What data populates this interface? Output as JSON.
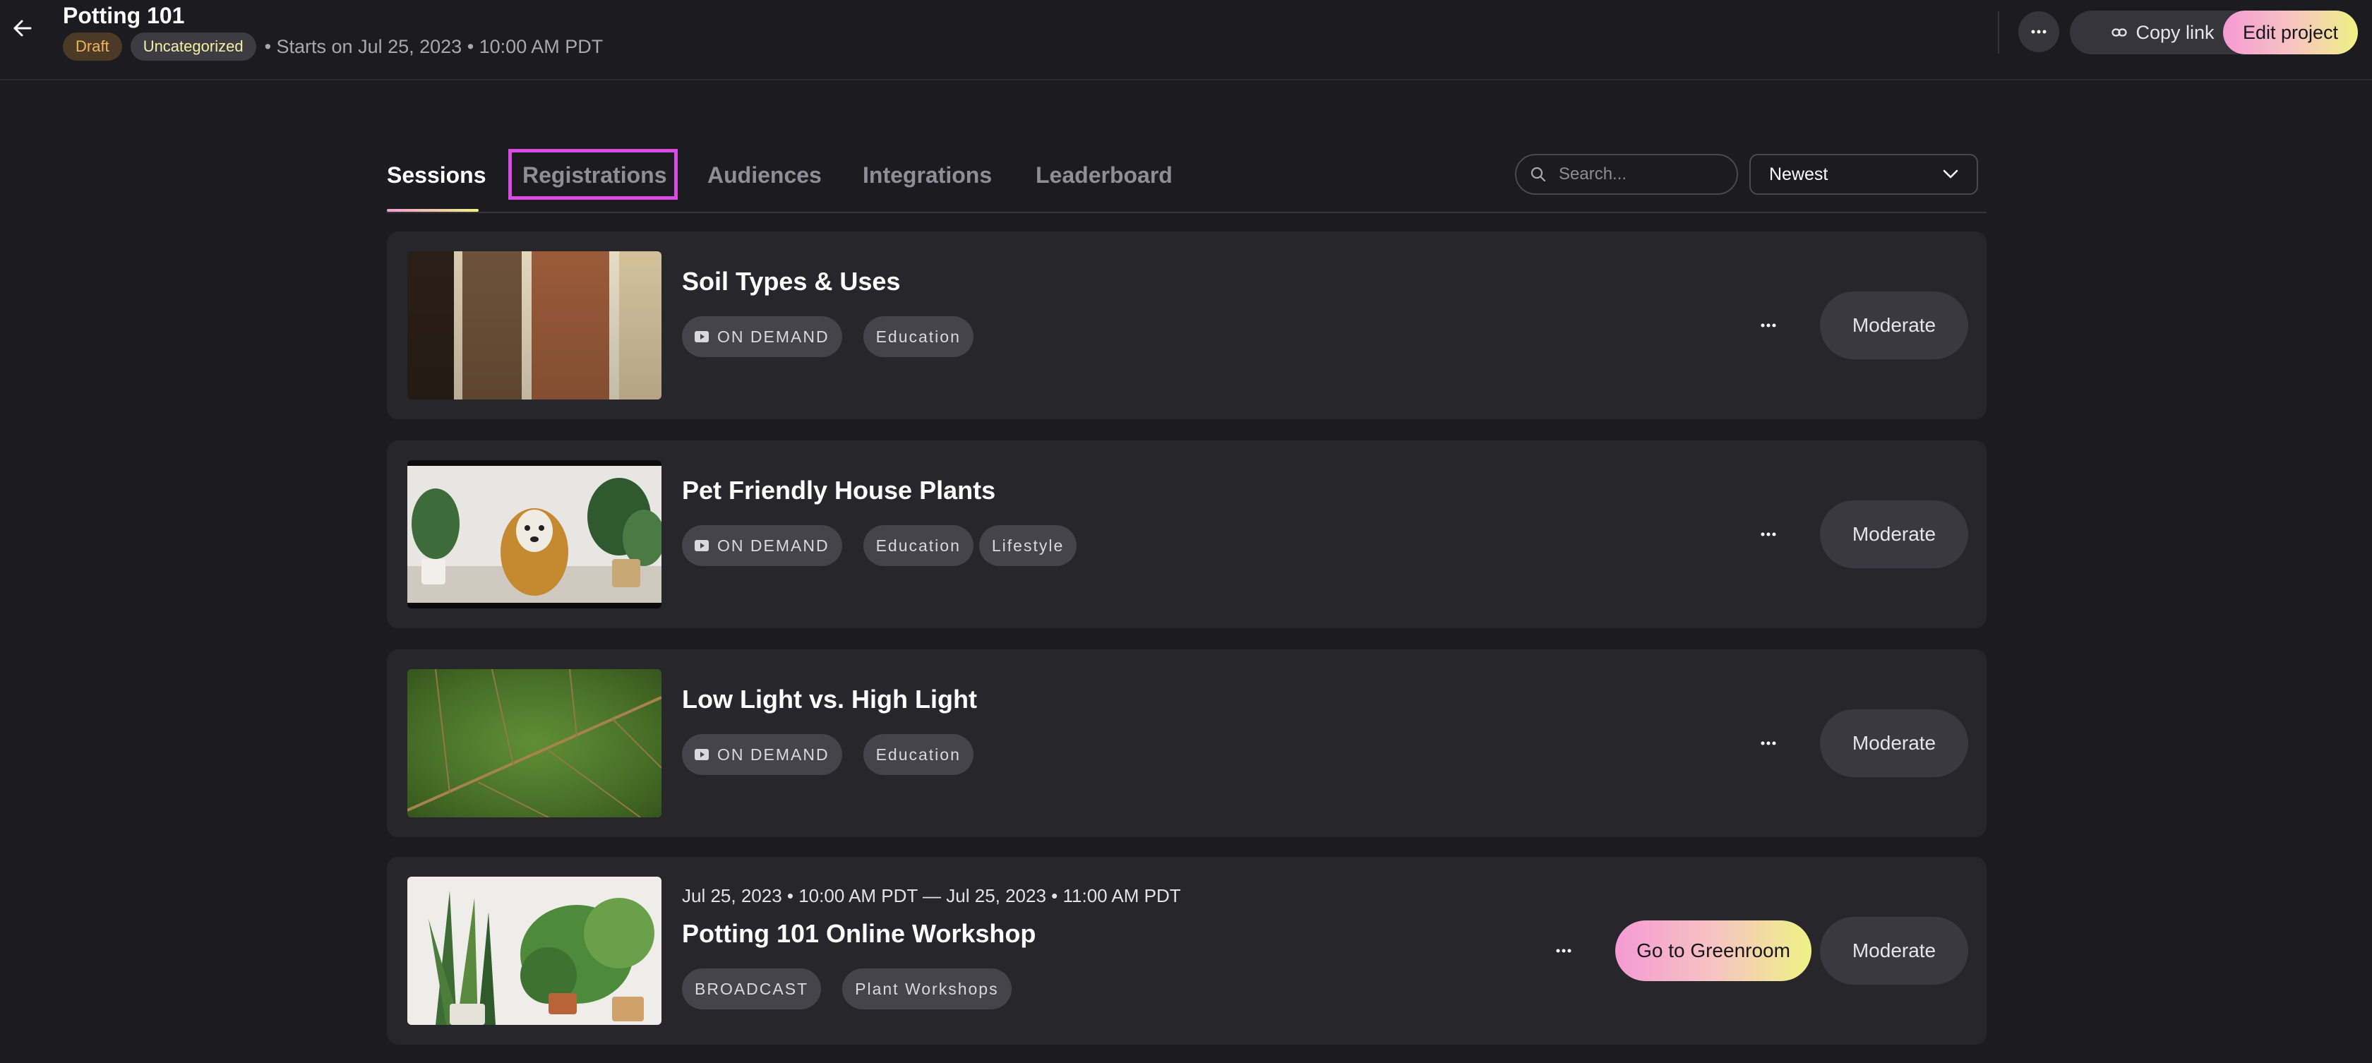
{
  "header": {
    "title": "Potting 101",
    "status_badge": "Draft",
    "category_badge": "Uncategorized",
    "starts_text": "• Starts on Jul 25, 2023 • 10:00 AM PDT",
    "copy_link_label": "Copy link",
    "edit_project_label": "Edit project",
    "more_label": "···"
  },
  "tabs": [
    {
      "label": "Sessions",
      "active": true
    },
    {
      "label": "Registrations",
      "active": false,
      "highlighted": true
    },
    {
      "label": "Audiences",
      "active": false
    },
    {
      "label": "Integrations",
      "active": false
    },
    {
      "label": "Leaderboard",
      "active": false
    }
  ],
  "search": {
    "placeholder": "Search..."
  },
  "sort": {
    "selected": "Newest"
  },
  "sessions": [
    {
      "title": "Soil Types & Uses",
      "type": "ON DEMAND",
      "tags": [
        "Education"
      ],
      "thumbnail": "soil-layers-image",
      "moderate_label": "Moderate"
    },
    {
      "title": "Pet Friendly House Plants",
      "type": "ON DEMAND",
      "tags": [
        "Education",
        "Lifestyle"
      ],
      "thumbnail": "dog-with-plants-image",
      "moderate_label": "Moderate"
    },
    {
      "title": "Low Light vs. High Light",
      "type": "ON DEMAND",
      "tags": [
        "Education"
      ],
      "thumbnail": "green-leaf-image",
      "moderate_label": "Moderate"
    },
    {
      "date_range": "Jul 25, 2023 • 10:00 AM PDT — Jul 25, 2023 • 11:00 AM PDT",
      "title": "Potting 101 Online Workshop",
      "type": "BROADCAST",
      "tags": [
        "Plant Workshops"
      ],
      "thumbnail": "potted-plants-image",
      "greenroom_label": "Go to Greenroom",
      "moderate_label": "Moderate"
    }
  ],
  "colors": {
    "background": "#1c1b20",
    "card": "#27262b",
    "accent_gradient_start": "#f59ad4",
    "accent_gradient_end": "#eef284",
    "highlight": "#d94be3"
  }
}
